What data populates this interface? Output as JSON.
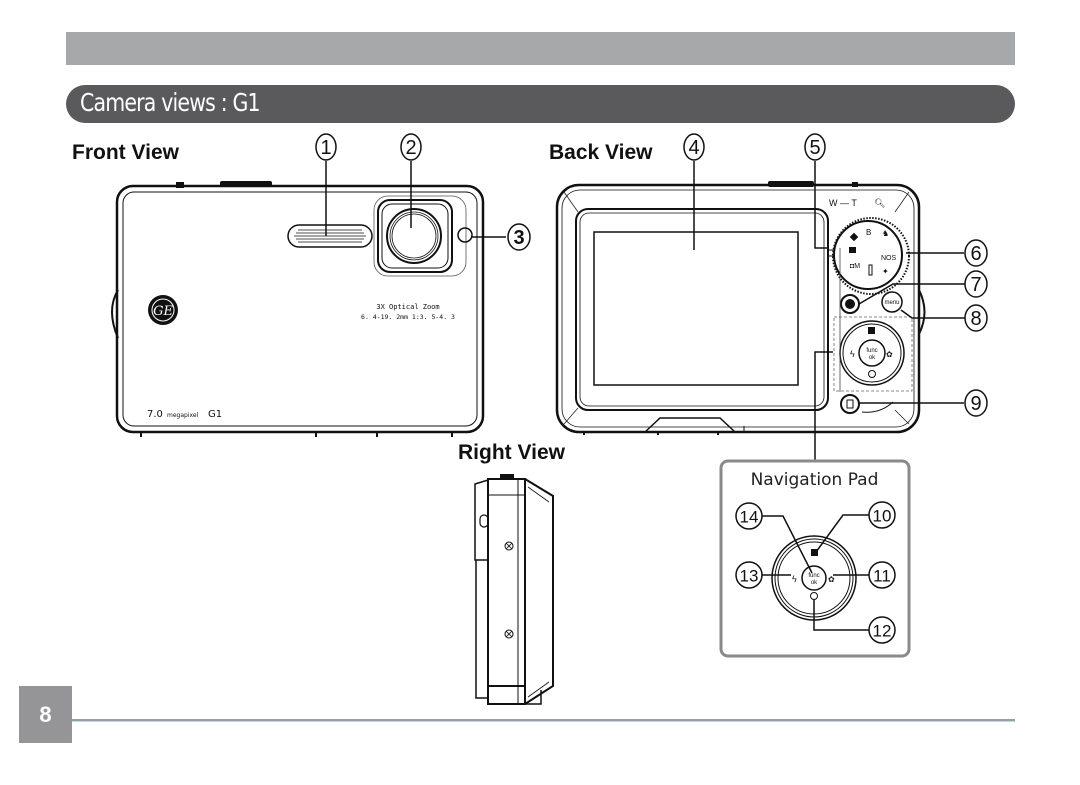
{
  "page": {
    "section_title": "Camera views : G1",
    "page_number": "8"
  },
  "front_view": {
    "label": "Front View",
    "callouts": [
      "1",
      "2",
      "3"
    ],
    "lens_text_line1": "3X Optical Zoom",
    "lens_text_line2": "6. 4-19. 2mm 1:3. 5-4. 3",
    "model_megapixel": "7.0",
    "model_megapixel_unit": "megapixel",
    "model_name": "G1",
    "logo": "GE"
  },
  "back_view": {
    "label": "Back View",
    "callouts": [
      "4",
      "5",
      "6",
      "7",
      "8",
      "9"
    ],
    "zoom_label": "W — T",
    "dial_mode_label": "NOS",
    "menu_button_label": "menu",
    "ok_button_line1": "func",
    "ok_button_line2": "ok"
  },
  "right_view": {
    "label": "Right View"
  },
  "navigation_pad": {
    "title": "Navigation Pad",
    "callouts": [
      "10",
      "11",
      "12",
      "13",
      "14"
    ],
    "ok_button_line1": "func",
    "ok_button_line2": "ok"
  },
  "colors": {
    "top_band": "#a7a8aa",
    "title_bar": "#5a5a5c",
    "page_box": "#959597",
    "nav_pad_border": "#8a8a8a"
  }
}
